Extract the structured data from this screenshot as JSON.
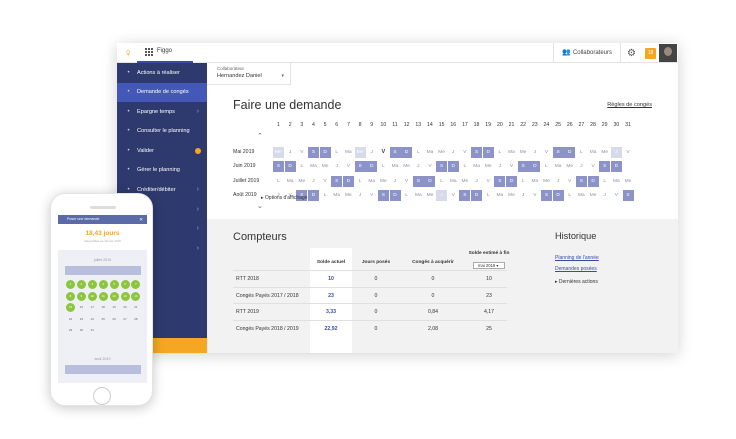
{
  "app": {
    "name": "Figgo",
    "logo": "figgo-logo",
    "notification_count": "18"
  },
  "topbar": {
    "collaborateurs_label": "Collaborateurs"
  },
  "sidebar": {
    "items": [
      {
        "label": "Actions à réaliser",
        "icon": "list-icon"
      },
      {
        "label": "Demande de congés",
        "icon": "send-icon",
        "active": true
      },
      {
        "label": "Epargne temps",
        "icon": "clock-icon",
        "chevron": true
      },
      {
        "label": "Consulter le planning",
        "icon": "calendar-icon"
      },
      {
        "label": "Valider",
        "icon": "check-icon",
        "dot": true
      },
      {
        "label": "Gérer le planning",
        "icon": "grid-icon"
      },
      {
        "label": "Créditer/débiter",
        "icon": "calendar-plus-icon",
        "chevron": true
      },
      {
        "label": "er",
        "icon": "",
        "chevron": true
      },
      {
        "label": "rts",
        "icon": "",
        "chevron": true
      },
      {
        "label": "urer",
        "icon": "",
        "chevron": true
      }
    ]
  },
  "collaborator": {
    "label": "Collaborateur",
    "value": "Hernandez Daniel"
  },
  "request": {
    "title": "Faire une demande",
    "rules_link": "Règles de congés",
    "options_label": "Options d'affichage",
    "day_numbers": [
      "1",
      "2",
      "3",
      "4",
      "5",
      "6",
      "7",
      "8",
      "9",
      "10",
      "11",
      "12",
      "13",
      "14",
      "15",
      "16",
      "17",
      "18",
      "19",
      "20",
      "21",
      "22",
      "23",
      "24",
      "25",
      "26",
      "27",
      "28",
      "29",
      "30",
      "31"
    ],
    "months": [
      {
        "label": "Mai 2019",
        "days": [
          "Me",
          "J",
          "V",
          "S",
          "D",
          "L",
          "Ma",
          "Me",
          "J",
          "V",
          "S",
          "D",
          "L",
          "Ma",
          "Me",
          "J",
          "V",
          "S",
          "D",
          "L",
          "Ma",
          "Me",
          "J",
          "V",
          "S",
          "D",
          "L",
          "Ma",
          "Me",
          "J",
          "V"
        ],
        "weekend": [
          4,
          5,
          11,
          12,
          18,
          19,
          25,
          26
        ],
        "holiday": [
          1,
          8,
          30
        ],
        "bold": [
          10
        ]
      },
      {
        "label": "Juin 2019",
        "days": [
          "S",
          "D",
          "L",
          "Ma",
          "Me",
          "J",
          "V",
          "S",
          "D",
          "L",
          "Ma",
          "Me",
          "J",
          "V",
          "S",
          "D",
          "L",
          "Ma",
          "Me",
          "J",
          "V",
          "S",
          "D",
          "L",
          "Ma",
          "Me",
          "J",
          "V",
          "S",
          "D",
          ""
        ],
        "weekend": [
          1,
          2,
          8,
          9,
          15,
          16,
          22,
          23,
          29,
          30
        ],
        "holiday": [],
        "bold": []
      },
      {
        "label": "Juillet 2019",
        "days": [
          "L",
          "Ma",
          "Me",
          "J",
          "V",
          "S",
          "D",
          "L",
          "Ma",
          "Me",
          "J",
          "V",
          "S",
          "D",
          "L",
          "Ma",
          "Me",
          "J",
          "V",
          "S",
          "D",
          "L",
          "Ma",
          "Me",
          "J",
          "V",
          "S",
          "D",
          "L",
          "Ma",
          "Me"
        ],
        "weekend": [
          6,
          7,
          13,
          14,
          20,
          21,
          27,
          28
        ],
        "holiday": [],
        "bold": []
      },
      {
        "label": "Août 2019",
        "days": [
          "J",
          "V",
          "S",
          "D",
          "L",
          "Ma",
          "Me",
          "J",
          "V",
          "S",
          "D",
          "L",
          "Ma",
          "Me",
          "J",
          "V",
          "S",
          "D",
          "L",
          "Ma",
          "Me",
          "J",
          "V",
          "S",
          "D",
          "L",
          "Ma",
          "Me",
          "J",
          "V",
          "S"
        ],
        "weekend": [
          3,
          4,
          10,
          11,
          17,
          18,
          24,
          25,
          31
        ],
        "holiday": [
          15
        ],
        "bold": []
      }
    ]
  },
  "compteurs": {
    "title": "Compteurs",
    "headers": [
      "Solde actuel",
      "Jours posés",
      "Congés à acquérir",
      "Solde estimé à fin"
    ],
    "year_select": "mai 2019",
    "rows": [
      {
        "name": "RTT 2018",
        "solde": "10",
        "poses": "0",
        "acquerir": "0",
        "estime": "10"
      },
      {
        "name": "Congés Payés 2017 / 2018",
        "solde": "23",
        "poses": "0",
        "acquerir": "0",
        "estime": "23"
      },
      {
        "name": "RTT 2019",
        "solde": "3,33",
        "poses": "0",
        "acquerir": "0,84",
        "estime": "4,17"
      },
      {
        "name": "Congés Payés 2018 / 2019",
        "solde": "22,92",
        "poses": "0",
        "acquerir": "2,08",
        "estime": "25"
      }
    ]
  },
  "historique": {
    "title": "Historique",
    "links": [
      "Planning de l'année",
      "Demandes posées"
    ],
    "more": "Dernières actions"
  },
  "phone": {
    "bar_title": "Poser une demande",
    "days": "18,43 jours",
    "subtitle": "disponibles au 10 mai 2019",
    "month1": "juillet 2019",
    "month2": "août 2019",
    "green_cells": 15,
    "green_start": 0
  }
}
